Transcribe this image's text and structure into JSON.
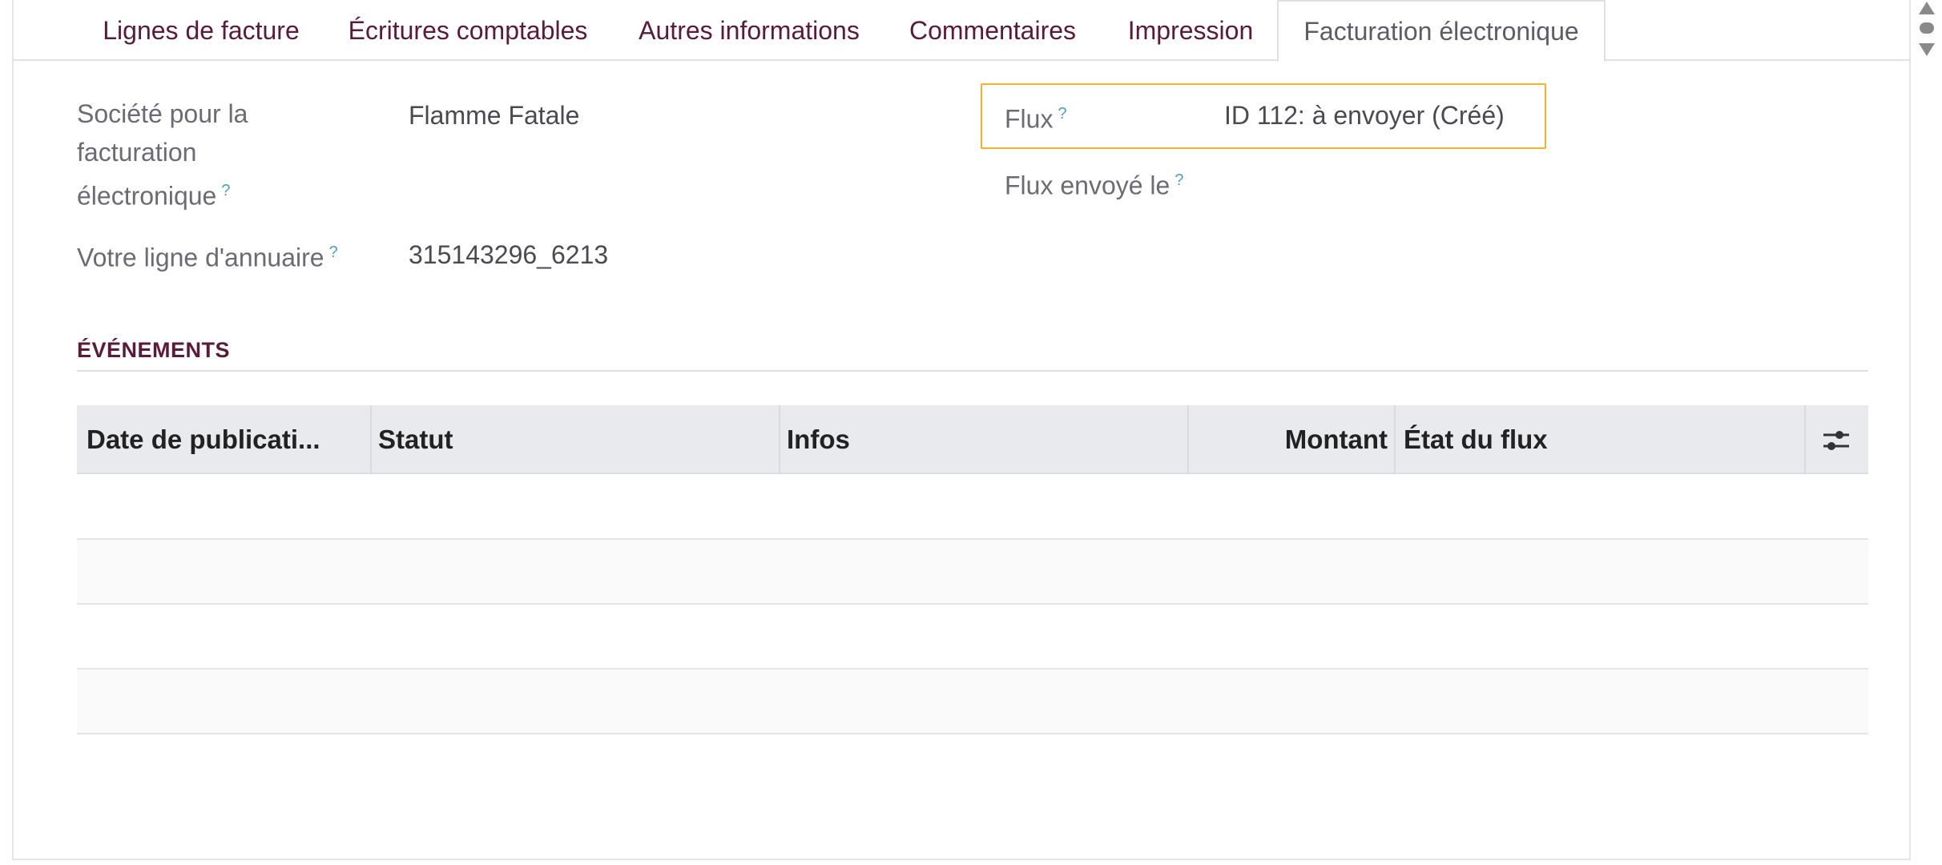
{
  "tabs": [
    {
      "label": "Lignes de facture"
    },
    {
      "label": "Écritures comptables"
    },
    {
      "label": "Autres informations"
    },
    {
      "label": "Commentaires"
    },
    {
      "label": "Impression"
    },
    {
      "label": "Facturation électronique",
      "active": true
    }
  ],
  "form": {
    "company_label_lines": [
      "Société pour la",
      "facturation",
      "électronique"
    ],
    "company_value": "Flamme Fatale",
    "directory_label": "Votre ligne d'annuaire",
    "directory_value": "315143296_6213",
    "flux_label": "Flux",
    "flux_value": "ID 112: à envoyer (Créé)",
    "flux_sent_label": "Flux envoyé le",
    "help_mark": "?"
  },
  "events": {
    "title": "ÉVÉNEMENTS",
    "columns": [
      "Date de publicati...",
      "Statut",
      "Infos",
      "Montant",
      "État du flux"
    ],
    "rows": []
  },
  "icons": {
    "settings": "sliders-icon",
    "scroll_up": "triangle-up-icon",
    "scroll_down": "triangle-down-icon"
  },
  "colors": {
    "tab_text": "#5b1a3a",
    "highlight_border": "#f3b324",
    "help_mark": "#4aa3c4"
  }
}
